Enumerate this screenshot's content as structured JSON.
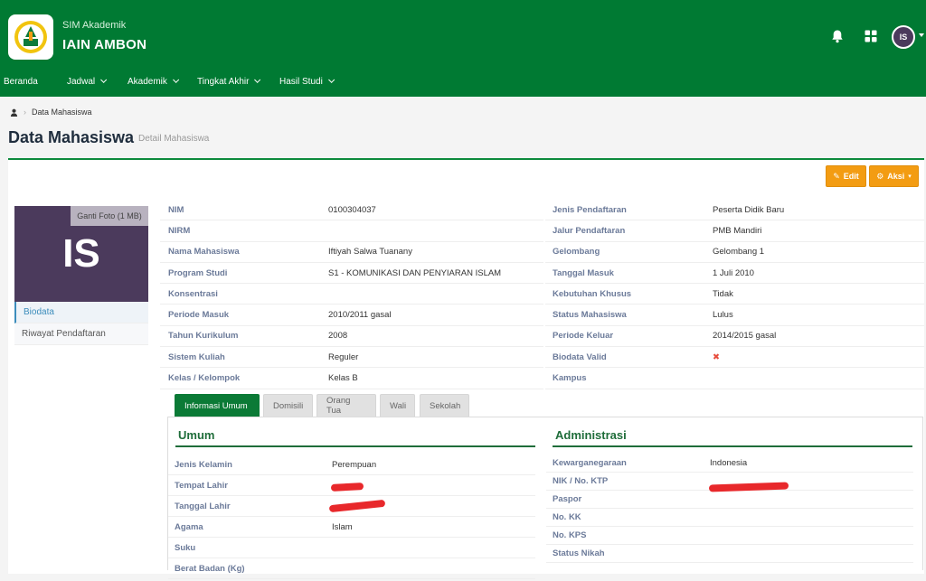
{
  "header": {
    "app_subtitle": "SIM Akademik",
    "app_name": "IAIN AMBON",
    "user_initials": "IS"
  },
  "nav": {
    "items": [
      {
        "label": "Beranda"
      },
      {
        "label": "Jadwal"
      },
      {
        "label": "Akademik"
      },
      {
        "label": "Tingkat Akhir"
      },
      {
        "label": "Hasil Studi"
      }
    ]
  },
  "breadcrumb": {
    "current": "Data Mahasiswa"
  },
  "page": {
    "title": "Data Mahasiswa",
    "subtitle": "Detail Mahasiswa"
  },
  "actions": {
    "edit": "Edit",
    "aksi": "Aksi"
  },
  "profile": {
    "initials": "IS",
    "change_photo": "Ganti Foto (1 MB)",
    "menu": [
      {
        "label": "Biodata"
      },
      {
        "label": "Riwayat Pendaftaran"
      }
    ]
  },
  "left_info": [
    {
      "label": "NIM",
      "value": "0100304037"
    },
    {
      "label": "NIRM",
      "value": ""
    },
    {
      "label": "Nama Mahasiswa",
      "value": "Iftiyah Salwa Tuanany"
    },
    {
      "label": "Program Studi",
      "value": "S1 - KOMUNIKASI DAN PENYIARAN ISLAM"
    },
    {
      "label": "Konsentrasi",
      "value": ""
    },
    {
      "label": "Periode Masuk",
      "value": "2010/2011 gasal"
    },
    {
      "label": "Tahun Kurikulum",
      "value": "2008"
    },
    {
      "label": "Sistem Kuliah",
      "value": "Reguler"
    },
    {
      "label": "Kelas / Kelompok",
      "value": "Kelas B"
    }
  ],
  "right_info": [
    {
      "label": "Jenis Pendaftaran",
      "value": "Peserta Didik Baru"
    },
    {
      "label": "Jalur Pendaftaran",
      "value": "PMB Mandiri"
    },
    {
      "label": "Gelombang",
      "value": "Gelombang 1"
    },
    {
      "label": "Tanggal Masuk",
      "value": "1 Juli 2010"
    },
    {
      "label": "Kebutuhan Khusus",
      "value": "Tidak"
    },
    {
      "label": "Status Mahasiswa",
      "value": "Lulus"
    },
    {
      "label": "Periode Keluar",
      "value": "2014/2015 gasal"
    },
    {
      "label": "Biodata Valid",
      "value": "✖"
    },
    {
      "label": "Kampus",
      "value": ""
    }
  ],
  "tabs": [
    {
      "label": "Informasi Umum"
    },
    {
      "label": "Domisili"
    },
    {
      "label": "Orang Tua"
    },
    {
      "label": "Wali"
    },
    {
      "label": "Sekolah"
    }
  ],
  "umum": {
    "title": "Umum",
    "rows": [
      {
        "label": "Jenis Kelamin",
        "value": "Perempuan"
      },
      {
        "label": "Tempat Lahir",
        "value": ""
      },
      {
        "label": "Tanggal Lahir",
        "value": ""
      },
      {
        "label": "Agama",
        "value": "Islam"
      },
      {
        "label": "Suku",
        "value": ""
      },
      {
        "label": "Berat Badan (Kg)",
        "value": ""
      }
    ]
  },
  "administrasi": {
    "title": "Administrasi",
    "rows": [
      {
        "label": "Kewarganegaraan",
        "value": "Indonesia"
      },
      {
        "label": "NIK / No. KTP",
        "value": ""
      },
      {
        "label": "Paspor",
        "value": ""
      },
      {
        "label": "No. KK",
        "value": ""
      },
      {
        "label": "No. KPS",
        "value": ""
      },
      {
        "label": "Status Nikah",
        "value": ""
      }
    ]
  }
}
